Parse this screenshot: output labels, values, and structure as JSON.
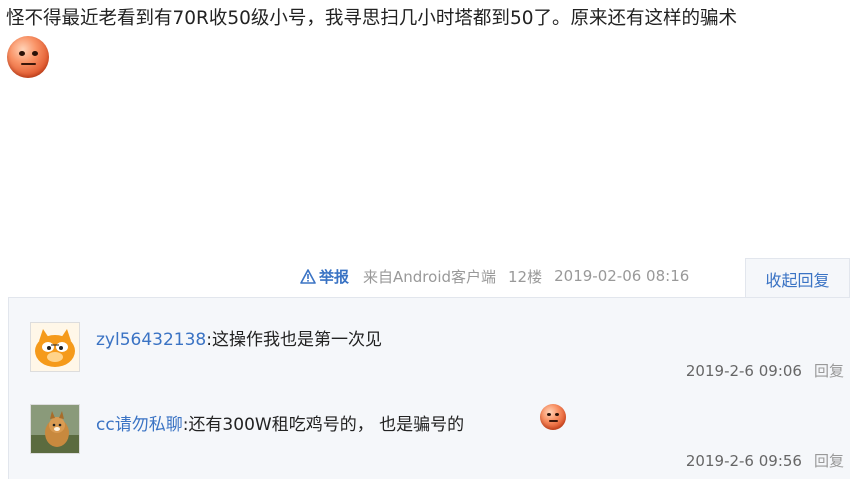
{
  "post": {
    "text": "怪不得最近老看到有70R收50级小号，我寻思扫几小时塔都到50了。原来还有这样的骗术",
    "emoji": "emoji-face"
  },
  "meta": {
    "report": "举报",
    "source": "来自Android客户端",
    "floor": "12楼",
    "datetime": "2019-02-06 08:16",
    "collapse": "收起回复"
  },
  "replies": [
    {
      "username": "zyl56432138",
      "separator": ":",
      "text": "这操作我也是第一次见",
      "time": "2019-2-6 09:06",
      "reply": "回复"
    },
    {
      "username": "cc请勿私聊",
      "separator": ":",
      "text": "还有300W租吃鸡号的， 也是骗号的",
      "time": "2019-2-6 09:56",
      "reply": "回复"
    }
  ],
  "colors": {
    "link": "#3a73c4",
    "panel": "#f5f7fa",
    "meta": "#999999"
  }
}
